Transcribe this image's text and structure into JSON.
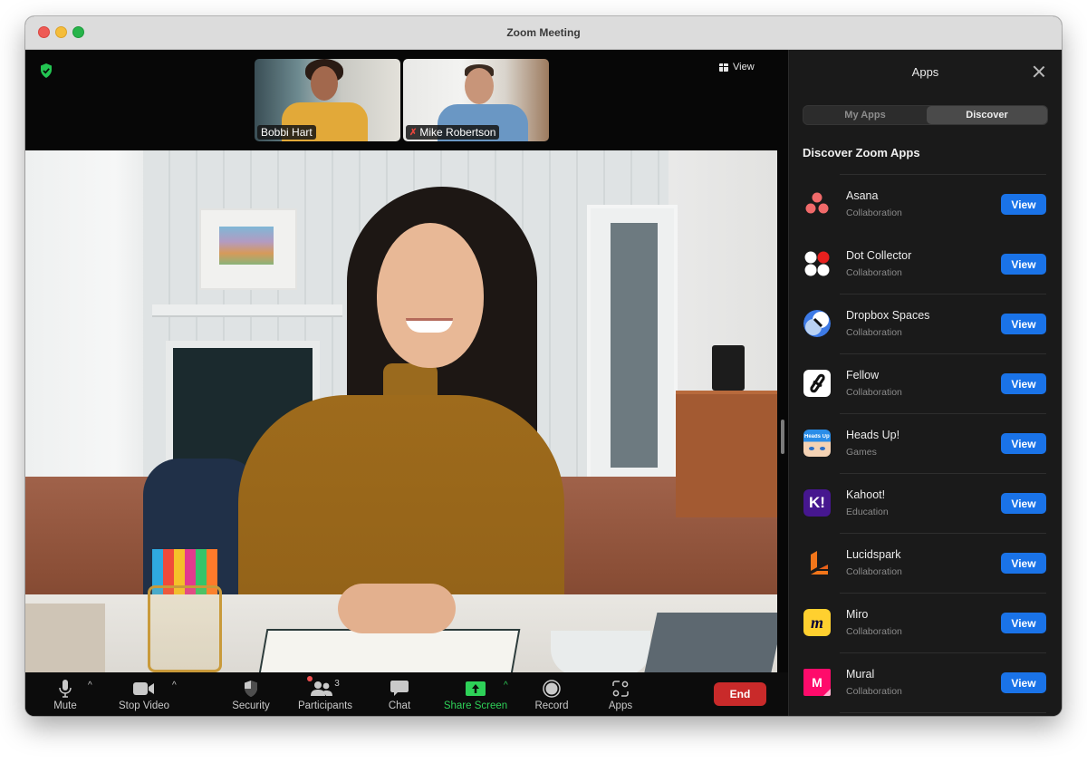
{
  "window": {
    "title": "Zoom Meeting"
  },
  "meeting": {
    "view_label": "View",
    "participants_thumbs": [
      {
        "name": "Bobbi Hart",
        "muted": false
      },
      {
        "name": "Mike Robertson",
        "muted": true
      }
    ],
    "icons": {
      "security_status": "shield-check-icon",
      "view": "grid-icon"
    }
  },
  "toolbar": {
    "mute": "Mute",
    "stop_video": "Stop Video",
    "security": "Security",
    "participants": "Participants",
    "participants_count": "3",
    "chat": "Chat",
    "share_screen": "Share Screen",
    "record": "Record",
    "apps": "Apps",
    "end": "End",
    "caret": "^",
    "colors": {
      "share_green": "#2ed158",
      "end_red": "#c92a2a"
    }
  },
  "apps_panel": {
    "title": "Apps",
    "tabs": [
      {
        "label": "My Apps",
        "selected": false
      },
      {
        "label": "Discover",
        "selected": true
      }
    ],
    "heading": "Discover Zoom Apps",
    "view_label": "View",
    "accent": "#1a73e8",
    "apps": [
      {
        "name": "Asana",
        "category": "Collaboration",
        "icon": "asana-icon"
      },
      {
        "name": "Dot Collector",
        "category": "Collaboration",
        "icon": "dot-collector-icon"
      },
      {
        "name": "Dropbox Spaces",
        "category": "Collaboration",
        "icon": "dropbox-spaces-icon"
      },
      {
        "name": "Fellow",
        "category": "Collaboration",
        "icon": "fellow-icon"
      },
      {
        "name": "Heads Up!",
        "category": "Games",
        "icon": "heads-up-icon"
      },
      {
        "name": "Kahoot!",
        "category": "Education",
        "icon": "kahoot-icon"
      },
      {
        "name": "Lucidspark",
        "category": "Collaboration",
        "icon": "lucidspark-icon"
      },
      {
        "name": "Miro",
        "category": "Collaboration",
        "icon": "miro-icon"
      },
      {
        "name": "Mural",
        "category": "Collaboration",
        "icon": "mural-icon"
      }
    ],
    "icon_texts": {
      "heads_up": "Heads Up!",
      "kahoot": "K!",
      "mural": "M",
      "miro": "m"
    }
  }
}
